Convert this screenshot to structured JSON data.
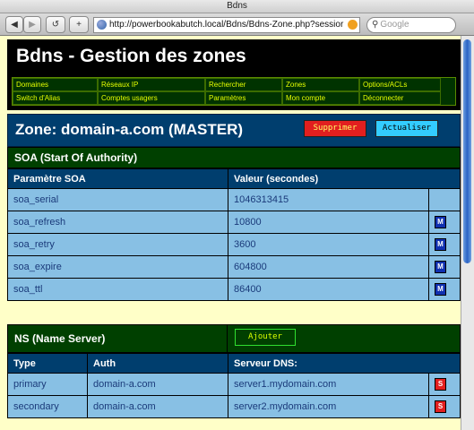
{
  "browser": {
    "window_title": "Bdns",
    "url": "http://powerbookabutch.local/Bdns/Bdns-Zone.php?sessior",
    "search_placeholder": "Google",
    "back_glyph": "◀",
    "forward_glyph": "▶",
    "reload_glyph": "↺",
    "add_glyph": "+"
  },
  "header": {
    "title": "Bdns - Gestion des zones"
  },
  "nav": [
    {
      "label": "Domaines"
    },
    {
      "label": "Réseaux IP"
    },
    {
      "label": "Rechercher"
    },
    {
      "label": "Zones"
    },
    {
      "label": "Options/ACLs"
    },
    {
      "label": "Switch d'Alias"
    },
    {
      "label": "Comptes usagers"
    },
    {
      "label": "Paramètres"
    },
    {
      "label": "Mon compte"
    },
    {
      "label": "Déconnecter"
    }
  ],
  "zone": {
    "title": "Zone: domain-a.com (MASTER)",
    "delete_label": "Supprimer",
    "refresh_label": "Actualiser"
  },
  "soa": {
    "section_title": "SOA (Start Of Authority)",
    "col_param": "Paramètre SOA",
    "col_value": "Valeur (secondes)",
    "rows": [
      {
        "param": "soa_serial",
        "value": "1046313415",
        "action": ""
      },
      {
        "param": "soa_refresh",
        "value": "10800",
        "action": "M"
      },
      {
        "param": "soa_retry",
        "value": "3600",
        "action": "M"
      },
      {
        "param": "soa_expire",
        "value": "604800",
        "action": "M"
      },
      {
        "param": "soa_ttl",
        "value": "86400",
        "action": "M"
      }
    ]
  },
  "ns": {
    "section_title": "NS (Name Server)",
    "add_label": "Ajouter",
    "col_type": "Type",
    "col_auth": "Auth",
    "col_server": "Serveur DNS:",
    "rows": [
      {
        "type": "primary",
        "auth": "domain-a.com",
        "server": "server1.mydomain.com",
        "action": "S"
      },
      {
        "type": "secondary",
        "auth": "domain-a.com",
        "server": "server2.mydomain.com",
        "action": "S"
      }
    ]
  },
  "colors": {
    "page_bg": "#ffffc8",
    "header_bg": "#000000",
    "section_bg": "#004000",
    "table_header_bg": "#003e6e",
    "cell_bg": "#88c0e4",
    "nav_text": "#e6ff00",
    "delete_bg": "#e21f1f",
    "refresh_bg": "#33ccff"
  }
}
